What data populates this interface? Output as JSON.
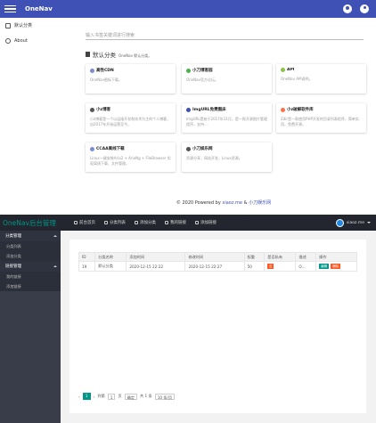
{
  "front": {
    "brand": "OneNav",
    "sidebar": [
      {
        "label": "默认分类",
        "icon": "bookmark-icon"
      },
      {
        "label": "About",
        "icon": "info-icon"
      }
    ],
    "search_placeholder": "输入书签关键词进行搜索",
    "category": {
      "title": "默认分类",
      "subtitle": "OneNav 默认分类。"
    },
    "cards": [
      {
        "title": "高性CDN",
        "desc": "OneNav图标下载。",
        "icon_color": "#7e8ccf"
      },
      {
        "title": "小刀博客园",
        "desc": "OneNav官方论坛。",
        "icon_color": "#4caf50"
      },
      {
        "title": "API",
        "desc": "OneNav API说明。",
        "icon_color": "#8bc34a"
      },
      {
        "title": "小z博客",
        "desc": "小z博客是一个以运维开发和技术为主的个人博客，自2017年开始运营至今。",
        "icon_color": "#555555"
      },
      {
        "title": "ImgURL免费图床",
        "desc": "ImgURL是始于2017年11月，是一款开源图片管理程序，支持...",
        "icon_color": "#3f51b5"
      },
      {
        "title": "小z破解软件库",
        "desc": "Zdir是一款使用PHP开发的目录列表程序，简单实用，免费开源。",
        "icon_color": "#ff7043"
      },
      {
        "title": "CCAA离线下载",
        "desc": "Linux一键安装Aria2 + AriaNg + FileBrowser 实现离线下载、文件管理。",
        "icon_color": "#7e8ccf"
      },
      {
        "title": "小刀娱乐网",
        "desc": "资源分享，网站开发，Linux资源。",
        "icon_color": "#555555"
      }
    ],
    "footer": {
      "prefix": "© 2020 Powered by ",
      "link1": "xiaoz.me",
      "mid": " & ",
      "link2": "小刀娱乐网"
    }
  },
  "admin": {
    "logo": "OneNav后台管理",
    "nav": [
      {
        "label": "前台首页",
        "icon": "home-icon"
      },
      {
        "label": "分类列表",
        "icon": "list-icon"
      },
      {
        "label": "添加分类",
        "icon": "add-icon"
      },
      {
        "label": "我的链接",
        "icon": "link-icon"
      },
      {
        "label": "添加链接",
        "icon": "add-link-icon"
      }
    ],
    "user": "xiaoz.me",
    "sidebar": [
      {
        "group": "分类管理",
        "items": [
          "分类列表",
          "添加分类"
        ]
      },
      {
        "group": "链接管理",
        "items": [
          "我的链接",
          "添加链接"
        ]
      }
    ],
    "table": {
      "headers": [
        "ID",
        "分类名称",
        "添加时间",
        "修改时间",
        "权重",
        "是否私有",
        "描述",
        "操作"
      ],
      "rows": [
        {
          "id": "19",
          "name": "默认分类",
          "added": "2020-12-15 22:22",
          "modified": "2020-12-15 22:27",
          "weight": "50",
          "private": "否",
          "desc": "O...",
          "edit": "编辑",
          "delete": "删除"
        }
      ]
    },
    "pager": {
      "current": "1",
      "goto_label": "到第",
      "page_value": "1",
      "page_suffix": "页",
      "confirm": "确定",
      "total": "共 1 条",
      "per_page": "10 条/页"
    }
  }
}
